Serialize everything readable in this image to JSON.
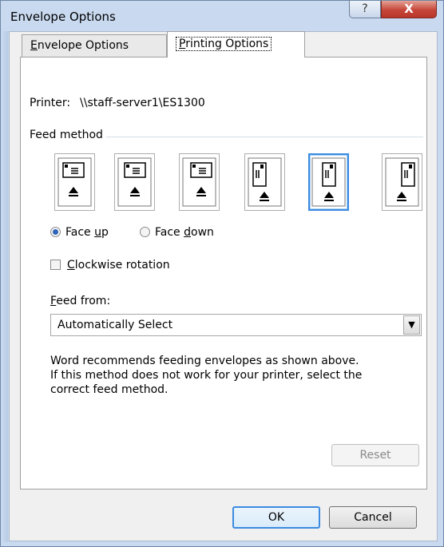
{
  "window": {
    "title": "Envelope Options",
    "help_glyph": "?",
    "close_glyph": "X"
  },
  "tabs": [
    {
      "label_u": "E",
      "label_rest": "nvelope Options",
      "active": false
    },
    {
      "label_u": "P",
      "label_rest": "rinting Options",
      "active": true
    }
  ],
  "printer": {
    "label": "Printer:",
    "value": "\\\\staff-server1\\ES1300"
  },
  "feed_method": {
    "label": "Feed method",
    "options": [
      {
        "icon": "envelope-horizontal-left-icon",
        "selected": false
      },
      {
        "icon": "envelope-horizontal-center-icon",
        "selected": false
      },
      {
        "icon": "envelope-horizontal-right-icon",
        "selected": false
      },
      {
        "icon": "envelope-vertical-left-icon",
        "selected": false
      },
      {
        "icon": "envelope-vertical-center-icon",
        "selected": true
      },
      {
        "icon": "envelope-vertical-right-icon",
        "selected": false
      }
    ]
  },
  "face": {
    "up_pre": "Face ",
    "up_u": "u",
    "up_post": "p",
    "up_checked": true,
    "down_pre": "Face ",
    "down_u": "d",
    "down_post": "own",
    "down_checked": false
  },
  "clockwise": {
    "label_u": "C",
    "label_rest": "lockwise rotation",
    "checked": false
  },
  "feed_from": {
    "label_u": "F",
    "label_rest": "eed from:",
    "value": "Automatically Select"
  },
  "description": [
    "Word recommends feeding envelopes as shown above.",
    "If this method does not work for your printer, select the",
    "correct feed method."
  ],
  "buttons": {
    "reset": "Reset",
    "ok": "OK",
    "cancel": "Cancel"
  },
  "colors": {
    "accent": "#3c8be0",
    "close": "#c6463a"
  }
}
